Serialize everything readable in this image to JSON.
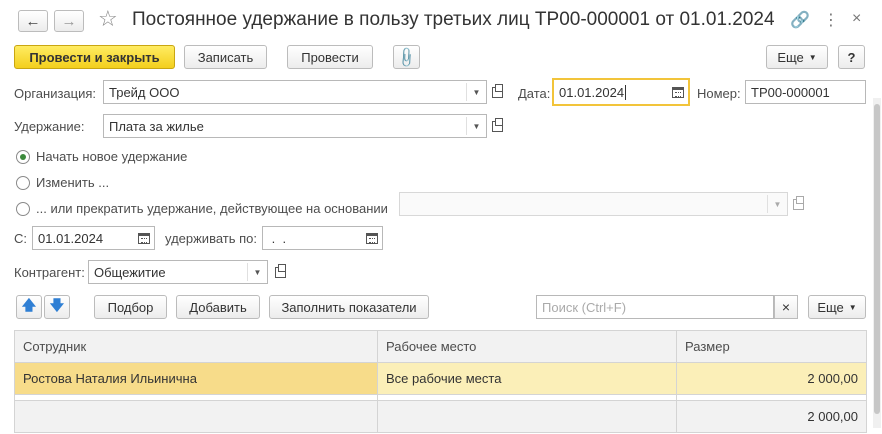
{
  "window": {
    "title": "Постоянное удержание в пользу третьих лиц ТР00-000001 от 01.01.2024"
  },
  "toolbar": {
    "post_close": "Провести и закрыть",
    "save": "Записать",
    "post": "Провести",
    "more": "Еще",
    "help": "?"
  },
  "form": {
    "org_label": "Организация:",
    "org_value": "Трейд ООО",
    "date_label": "Дата:",
    "date_value": "01.01.2024",
    "number_label": "Номер:",
    "number_value": "ТР00-000001",
    "deduction_label": "Удержание:",
    "deduction_value": "Плата за жилье",
    "radio_new": "Начать новое удержание",
    "radio_change": "Изменить ...",
    "radio_stop": "... или прекратить удержание, действующее на основании",
    "from_label": "С:",
    "from_value": "01.01.2024",
    "withhold_label": "удерживать по:",
    "withhold_value": " .  .",
    "contractor_label": "Контрагент:",
    "contractor_value": "Общежитие"
  },
  "table_toolbar": {
    "pick": "Подбор",
    "add": "Добавить",
    "fill": "Заполнить показатели",
    "search_placeholder": "Поиск (Ctrl+F)",
    "clear": "×",
    "more": "Еще"
  },
  "table": {
    "headers": [
      "Сотрудник",
      "Рабочее место",
      "Размер"
    ],
    "rows": [
      [
        "Ростова Наталия Ильинична",
        "Все рабочие места",
        "2 000,00"
      ]
    ],
    "total": "2 000,00"
  },
  "colors": {
    "accent_yellow": "#f3cf1d",
    "selected_row": "#fbefb8",
    "arrow_blue": "#2f7fd4"
  }
}
